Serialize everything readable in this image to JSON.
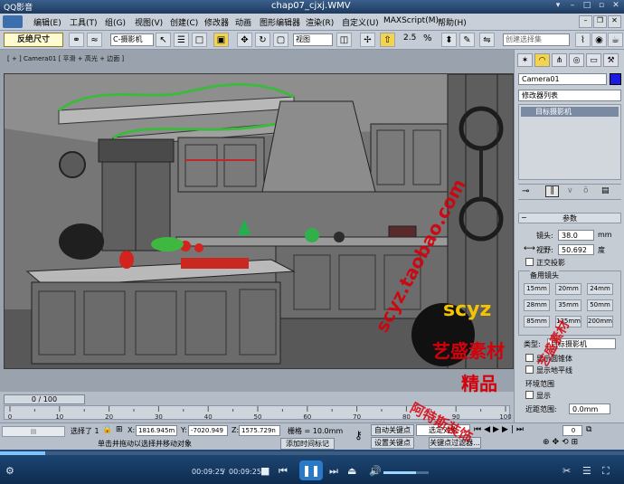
{
  "player": {
    "app_title": "QQ影音",
    "file_title": "chap07_cjxj.WMV",
    "time_current": "00:09:25",
    "time_total": "00:09:25",
    "time_separator": "/"
  },
  "max": {
    "menus": [
      "编辑(E)",
      "工具(T)",
      "组(G)",
      "视图(V)",
      "创建(C)",
      "修改器",
      "动画",
      "图形编辑器",
      "渲染(R)",
      "自定义(U)",
      "MAXScript(M)",
      "帮助(H)"
    ],
    "toolbar": {
      "hint_badge": "反绝尺寸",
      "selection_filter": "C-摄影机",
      "ref_coord": "视图",
      "angle_snap": "2.5",
      "percent_snap": "%",
      "named_selection_placeholder": "创建选择集"
    },
    "viewport_label": "[ + ] Camera01 [ 平滑 + 高光 + 边面 ]",
    "right_panel": {
      "object_name": "Camera01",
      "modifier_list": "修改器列表",
      "stack_item": "目标摄影机",
      "rollout_title": "参数",
      "lens_label": "镜头:",
      "lens_value": "38.0",
      "lens_unit": "mm",
      "fov_label": "视野:",
      "fov_value": "50.692",
      "fov_unit": "度",
      "ortho_label": "正交投影",
      "stock_lenses_label": "备用镜头",
      "stock_lenses": [
        "15mm",
        "20mm",
        "24mm",
        "28mm",
        "35mm",
        "50mm",
        "85mm",
        "135mm",
        "200mm"
      ],
      "type_label": "类型:",
      "type_value": "目标摄影机",
      "show_cone": "显示圆锥体",
      "show_horizon": "显示地平线",
      "env_label": "环境范围",
      "env_show": "显示",
      "near_label": "近距范围:",
      "near_value": "0.0mm"
    },
    "timeline": {
      "frame": "0 / 100",
      "ticks": [
        "0",
        "10",
        "20",
        "30",
        "40",
        "50",
        "60",
        "70",
        "80",
        "90",
        "100"
      ]
    },
    "status": {
      "selected": "选择了 1",
      "x_label": "X:",
      "x_value": "1816.945m",
      "y_label": "Y:",
      "y_value": "-7020.949",
      "z_label": "Z:",
      "z_value": "1575.729n",
      "grid": "栅格 = 10.0mm",
      "auto_key": "自动关键点",
      "selected_object": "选定对象",
      "set_key": "设置关键点",
      "key_filters": "关键点过滤器...",
      "add_time_tag": "添加时间标记",
      "prompt": "单击并拖动以选择并移动对象",
      "welcome": "欢迎使用"
    },
    "camera_nav_time": "0"
  },
  "watermark": {
    "url": "scyz.taobao.com",
    "brand": "scyz",
    "line1": "艺盛素材",
    "line2": "精品",
    "side_text": "阿特斯装饰",
    "shop_text": "艺盛素材"
  },
  "colors": {
    "accent": "#1d3a5e",
    "watermark_red": "#d4000a",
    "viewport_bg": "#6f6f6f"
  }
}
